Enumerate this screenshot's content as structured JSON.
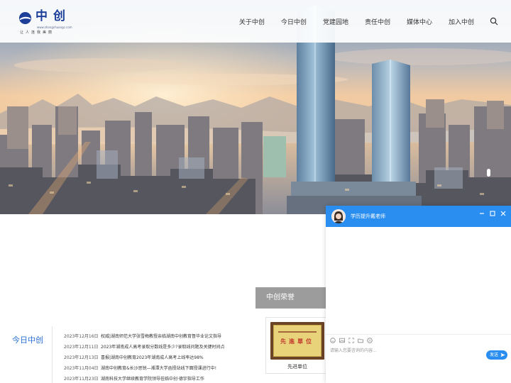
{
  "brand": {
    "name": "中创",
    "url": "www.zhongchuangc.com",
    "slogan": "让人连我美丽"
  },
  "nav": {
    "items": [
      "关于中创",
      "今日中创",
      "党建园地",
      "责任中创",
      "媒体中心",
      "加入中创"
    ],
    "search_icon": "search-icon"
  },
  "honor": {
    "title": "中创荣誉",
    "certificate_text": "先進單位",
    "caption": "先进单位"
  },
  "today": {
    "title": "今日中创",
    "news": [
      {
        "date": "2023年12月16日",
        "title": "权威|湖南师范大学张雪梅教授亲临湖南中创教育督毕业论文指导"
      },
      {
        "date": "2023年12月11日",
        "title": "2023年湖南成人高考录取分数线是多少?录取线问题及关键时间点"
      },
      {
        "date": "2023年12月13日",
        "title": "喜报|湖南中创教育2023年湖南成人高考上线率达98%"
      },
      {
        "date": "2023年11月04日",
        "title": "湖南中创教育&长沙思锐—湘潭大学函授站线下面授课进行中!"
      },
      {
        "date": "2023年11月23日",
        "title": "湖南科技大学继续教育学院领导莅临中创·德宇指导工作"
      }
    ]
  },
  "chat": {
    "agent_name": "学历提升戴老师",
    "input_placeholder": "请输入您要咨询的内容...",
    "send_label": "发送",
    "controls": [
      "minimize-icon",
      "maximize-icon",
      "close-icon"
    ],
    "tools": [
      "emoji-icon",
      "image-icon",
      "screenshot-icon",
      "folder-icon",
      "rating-icon"
    ]
  },
  "colors": {
    "brand_blue": "#1d3f9a",
    "accent_blue": "#2a8ef0",
    "today_title": "#2a6fd1",
    "honor_header": "#9c9c9c"
  }
}
